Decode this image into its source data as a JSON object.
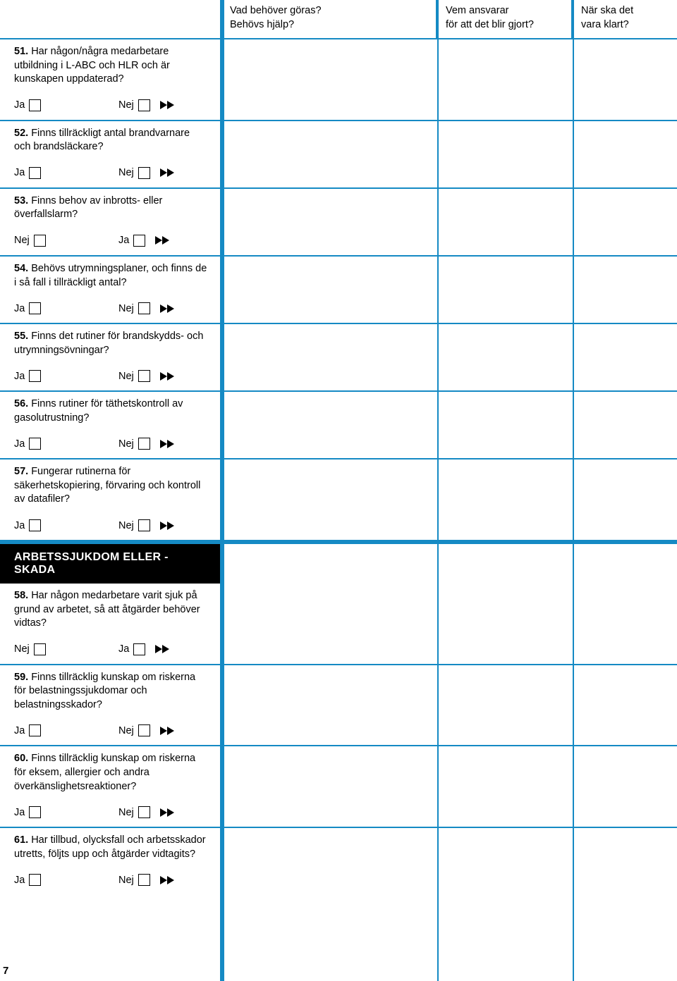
{
  "headers": {
    "col1_line1": "Vad behöver göras?",
    "col1_line2": "Behövs hjälp?",
    "col2_line1": "Vem ansvarar",
    "col2_line2": "för att det blir gjort?",
    "col3_line1": "När ska det",
    "col3_line2": "vara klart?"
  },
  "labels": {
    "ja": "Ja",
    "nej": "Nej"
  },
  "section_title": "ARBETSSJUKDOM ELLER -SKADA",
  "page_number": "7",
  "questions": [
    {
      "num": "51.",
      "text": "Har någon/några medarbetare utbildning i L-ABC och HLR och är kunskapen uppdaterad?",
      "first": "ja",
      "second": "nej"
    },
    {
      "num": "52.",
      "text": "Finns tillräckligt antal brandvarnare och brandsläckare?",
      "first": "ja",
      "second": "nej"
    },
    {
      "num": "53.",
      "text": "Finns behov av inbrotts- eller överfallslarm?",
      "first": "nej",
      "second": "ja"
    },
    {
      "num": "54.",
      "text": "Behövs utrymningsplaner, och finns de i så fall i tillräckligt antal?",
      "first": "ja",
      "second": "nej"
    },
    {
      "num": "55.",
      "text": "Finns det rutiner för brandskydds- och utrymningsövningar?",
      "first": "ja",
      "second": "nej"
    },
    {
      "num": "56.",
      "text": "Finns rutiner för täthetskontroll av gasolutrustning?",
      "first": "ja",
      "second": "nej"
    },
    {
      "num": "57.",
      "text": "Fungerar rutinerna för säkerhetskopiering, förvaring och kontroll av datafiler?",
      "first": "ja",
      "second": "nej"
    },
    {
      "num": "58.",
      "text": "Har någon medarbetare varit sjuk på grund av arbetet, så att åtgärder behöver vidtas?",
      "first": "nej",
      "second": "ja"
    },
    {
      "num": "59.",
      "text": "Finns tillräcklig kunskap om riskerna för belastningssjukdomar och belastningsskador?",
      "first": "ja",
      "second": "nej"
    },
    {
      "num": "60.",
      "text": "Finns tillräcklig kunskap om riskerna för eksem, allergier och andra överkänslighetsreaktioner?",
      "first": "ja",
      "second": "nej"
    },
    {
      "num": "61.",
      "text": "Har tillbud, olycksfall och arbetsskador utretts, följts upp och åtgärder vidtagits?",
      "first": "ja",
      "second": "nej"
    }
  ]
}
